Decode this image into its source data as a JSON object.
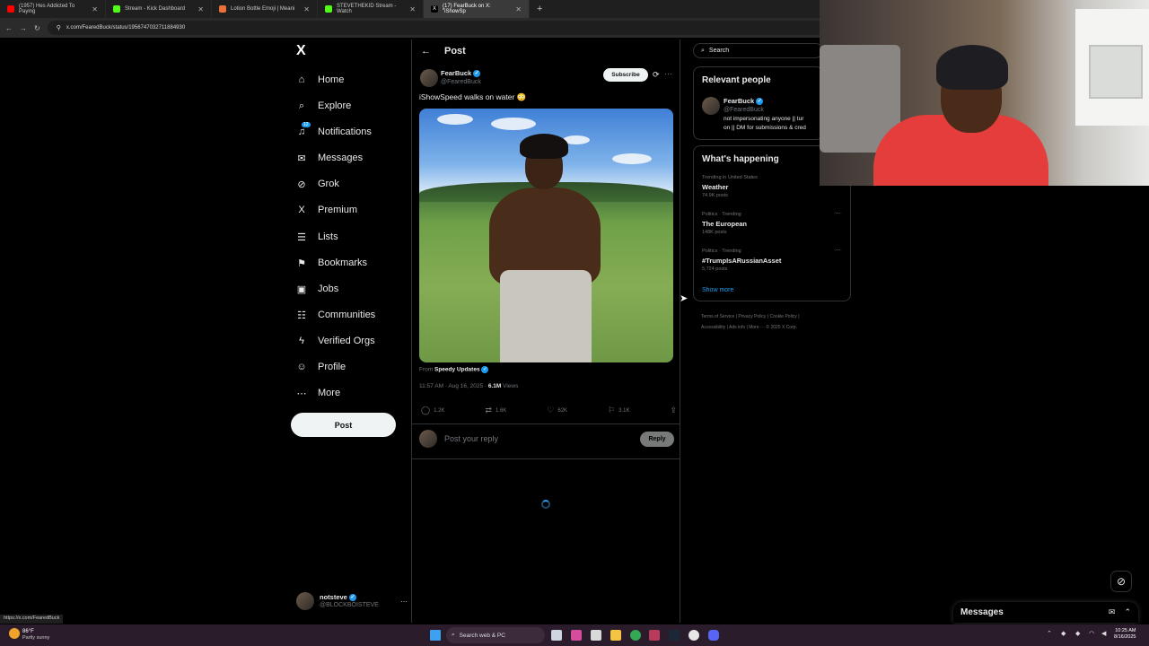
{
  "browser": {
    "tabs": [
      {
        "label": "(1957) Hes Addicted To Paying",
        "color": "#ff0000"
      },
      {
        "label": "Stream - Kick Dashboard",
        "color": "#53fc18"
      },
      {
        "label": "Lotion Bottle Emoji | Meani",
        "color": "#e8723a"
      },
      {
        "label": "STEVETHEKID Stream - Watch",
        "color": "#53fc18"
      },
      {
        "label": "(17) FearBuck on X: \"iShowSp",
        "color": "#ffffff"
      }
    ],
    "url": "x.com/FearedBuck/status/1956747032711884930",
    "hover_url": "https://x.com/FearedBuck"
  },
  "nav": {
    "logo": "X",
    "items": [
      {
        "label": "Home",
        "icon": "⌂",
        "name": "home"
      },
      {
        "label": "Explore",
        "icon": "⌕",
        "name": "explore"
      },
      {
        "label": "Notifications",
        "icon": "♫",
        "name": "notifications",
        "badge": "12"
      },
      {
        "label": "Messages",
        "icon": "✉",
        "name": "messages"
      },
      {
        "label": "Grok",
        "icon": "⊘",
        "name": "grok"
      },
      {
        "label": "Premium",
        "icon": "X",
        "name": "premium"
      },
      {
        "label": "Lists",
        "icon": "☰",
        "name": "lists"
      },
      {
        "label": "Bookmarks",
        "icon": "⚑",
        "name": "bookmarks"
      },
      {
        "label": "Jobs",
        "icon": "▣",
        "name": "jobs"
      },
      {
        "label": "Communities",
        "icon": "☷",
        "name": "communities"
      },
      {
        "label": "Verified Orgs",
        "icon": "ϟ",
        "name": "verified-orgs"
      },
      {
        "label": "Profile",
        "icon": "☺",
        "name": "profile"
      },
      {
        "label": "More",
        "icon": "⋯",
        "name": "more"
      }
    ],
    "post_button": "Post",
    "account": {
      "name": "notsteve",
      "handle": "@BLOCKBOISTEVE",
      "more": "···"
    }
  },
  "post": {
    "header": "Post",
    "back": "←",
    "author": "FearBuck",
    "handle": "@FearedBuck",
    "subscribe": "Subscribe",
    "text": "iShowSpeed walks on water 😳",
    "from_label": "From",
    "from_account": "Speedy Updates",
    "timestamp": "11:57 AM · Aug 16, 2025 · ",
    "views_count": "6.1M",
    "views_label": "Views",
    "replies": "1.2K",
    "reposts": "1.6K",
    "likes": "62K",
    "bookmarks": "3.1K",
    "reply_placeholder": "Post your reply",
    "reply_button": "Reply"
  },
  "sidebar": {
    "search_placeholder": "Search",
    "relevant_title": "Relevant people",
    "relevant_person": {
      "name": "FearBuck",
      "handle": "@FearedBuck",
      "bio_line1": "not impersonating anyone || tur",
      "bio_line2": "on || DM for submissions & cred"
    },
    "happening_title": "What's happening",
    "trends": [
      {
        "meta": "Trending in United States",
        "name": "Weather",
        "count": "74.9K posts"
      },
      {
        "meta": "Politics · Trending",
        "name": "The European",
        "count": "148K posts"
      },
      {
        "meta": "Politics · Trending",
        "name": "#TrumpIsARussianAsset",
        "count": "5,724 posts"
      }
    ],
    "show_more": "Show more",
    "footer": {
      "terms": "Terms of Service",
      "privacy": "Privacy Policy",
      "cookie": "Cookie Policy",
      "accessibility": "Accessibility",
      "ads": "Ads info",
      "more": "More ···",
      "copyright": "© 2025 X Corp."
    }
  },
  "messages_drawer": {
    "title": "Messages"
  },
  "taskbar": {
    "weather_temp": "86°F",
    "weather_desc": "Partly sunny",
    "search": "Search web & PC",
    "time": "10:25 AM",
    "date": "8/16/2025"
  },
  "colors": {
    "accent": "#1d9bf0",
    "border": "#2f3336",
    "muted": "#71767b"
  }
}
